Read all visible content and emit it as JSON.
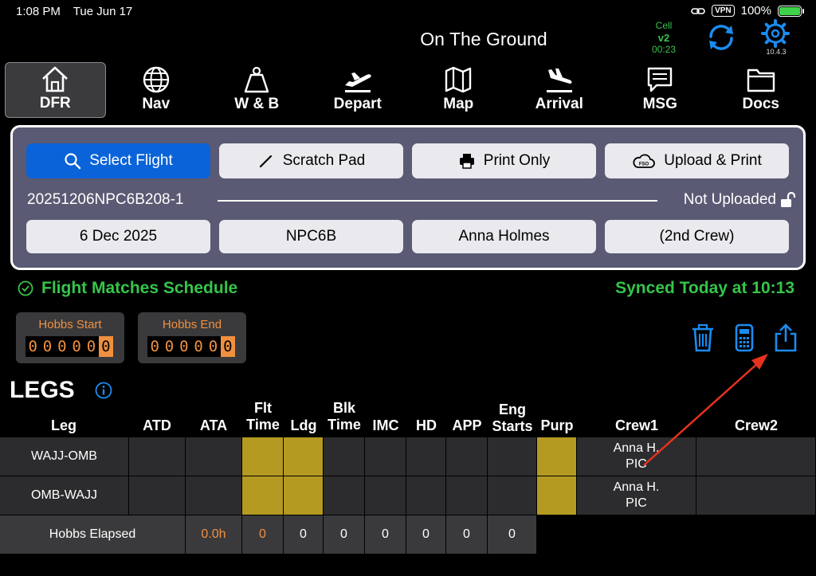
{
  "status": {
    "time": "1:08 PM",
    "date": "Tue Jun 17",
    "vpn": "VPN",
    "battery": "100%"
  },
  "header": {
    "title": "On The Ground",
    "cell_label": "Cell",
    "cell_version": "v2",
    "cell_timer": "00:23",
    "app_version": "10.4.3"
  },
  "nav": [
    {
      "label": "DFR",
      "icon": "home-icon"
    },
    {
      "label": "Nav",
      "icon": "globe-icon"
    },
    {
      "label": "W & B",
      "icon": "weight-icon"
    },
    {
      "label": "Depart",
      "icon": "departure-icon"
    },
    {
      "label": "Map",
      "icon": "map-icon"
    },
    {
      "label": "Arrival",
      "icon": "arrival-icon"
    },
    {
      "label": "MSG",
      "icon": "message-icon"
    },
    {
      "label": "Docs",
      "icon": "folder-icon"
    }
  ],
  "card": {
    "select_flight": "Select Flight",
    "scratch_pad": "Scratch Pad",
    "print_only": "Print Only",
    "upload_print": "Upload & Print",
    "fso_label": "FSO",
    "flight_id": "20251206NPC6B208-1",
    "upload_status": "Not Uploaded",
    "date": "6 Dec 2025",
    "aircraft": "NPC6B",
    "pilot": "Anna Holmes",
    "second_crew": "(2nd Crew)"
  },
  "schedule": {
    "match": "Flight Matches Schedule",
    "synced": "Synced Today at 10:13"
  },
  "hobbs": {
    "start_label": "Hobbs Start",
    "end_label": "Hobbs End",
    "start_digits": [
      "0",
      "0",
      "0",
      "0",
      "0",
      "0"
    ],
    "end_digits": [
      "0",
      "0",
      "0",
      "0",
      "0",
      "0"
    ]
  },
  "legs": {
    "title": "LEGS",
    "headers": {
      "leg": "Leg",
      "atd": "ATD",
      "ata": "ATA",
      "flt_1": "Flt",
      "flt_2": "Time",
      "ldg": "Ldg",
      "blk_1": "Blk",
      "blk_2": "Time",
      "imc": "IMC",
      "hd": "HD",
      "app": "APP",
      "eng_1": "Eng",
      "eng_2": "Starts",
      "purp": "Purp",
      "crew1": "Crew1",
      "crew2": "Crew2"
    },
    "rows": [
      {
        "leg": "WAJJ-OMB",
        "crew1_name": "Anna H.",
        "crew1_role": "PIC"
      },
      {
        "leg": "OMB-WAJJ",
        "crew1_name": "Anna H.",
        "crew1_role": "PIC"
      }
    ],
    "footer": {
      "label": "Hobbs Elapsed",
      "ata": "0.0h",
      "flt": "0",
      "ldg": "0",
      "blk": "0",
      "imc": "0",
      "hd": "0",
      "app": "0",
      "eng": "0"
    }
  },
  "colors": {
    "accent_blue": "#0a63d8",
    "green": "#35c54a",
    "orange": "#f09040",
    "yellow_cell": "#b59a22",
    "card_bg": "#5a5a74"
  }
}
